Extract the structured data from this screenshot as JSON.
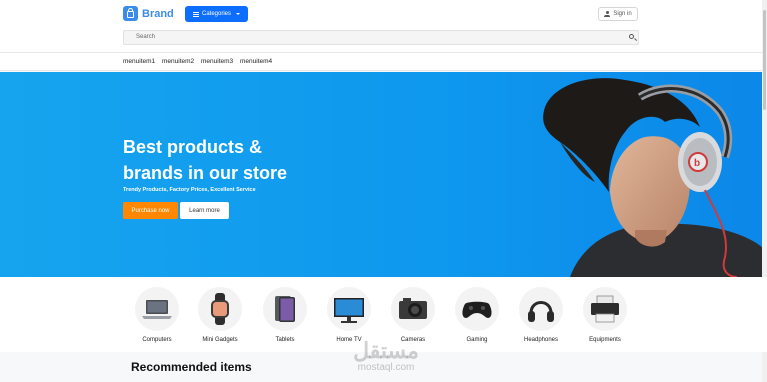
{
  "header": {
    "brand_name": "Brand",
    "categories_label": "Categories",
    "signin_label": "Sign in",
    "search_placeholder": "Search"
  },
  "menu": {
    "items": [
      "menuitem1",
      "menuitem2",
      "menuitem3",
      "menuitem4"
    ]
  },
  "hero": {
    "title_line1": "Best products &",
    "title_line2": "brands in our store",
    "subtitle": "Trendy Products, Factory Prices, Excellent Service",
    "primary_cta": "Purchase now",
    "secondary_cta": "Learn more"
  },
  "categories": [
    {
      "label": "Computers",
      "icon": "laptop-icon"
    },
    {
      "label": "Mini Gadgets",
      "icon": "smartwatch-icon"
    },
    {
      "label": "Tablets",
      "icon": "tablet-icon"
    },
    {
      "label": "Home TV",
      "icon": "tv-icon"
    },
    {
      "label": "Cameras",
      "icon": "camera-icon"
    },
    {
      "label": "Gaming",
      "icon": "gamepad-icon"
    },
    {
      "label": "Headphones",
      "icon": "headphones-icon"
    },
    {
      "label": "Equipments",
      "icon": "printer-icon"
    }
  ],
  "recommended": {
    "title": "Recommended items"
  },
  "watermark": {
    "arabic": "مستقل",
    "latin": "mostaql.com"
  },
  "colors": {
    "brand_blue": "#3b8beb",
    "primary_button": "#0d6efd",
    "hero_bg": "#0e97ee",
    "purchase_orange": "#ff8800"
  }
}
